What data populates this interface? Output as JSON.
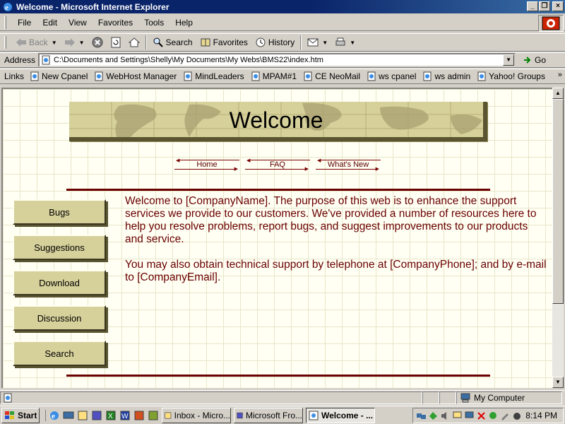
{
  "window": {
    "title": "Welcome - Microsoft Internet Explorer"
  },
  "menu": [
    "File",
    "Edit",
    "View",
    "Favorites",
    "Tools",
    "Help"
  ],
  "toolbar": {
    "back": "Back",
    "search": "Search",
    "favorites": "Favorites",
    "history": "History"
  },
  "address": {
    "label": "Address",
    "value": "C:\\Documents and Settings\\Shelly\\My Documents\\My Webs\\BMS22\\index.htm",
    "go": "Go"
  },
  "links": {
    "label": "Links",
    "items": [
      "New Cpanel",
      "WebHost Manager",
      "MindLeaders",
      "MPAM#1",
      "CE NeoMail",
      "ws cpanel",
      "ws admin",
      "Yahoo! Groups"
    ],
    "more": "»"
  },
  "page": {
    "banner_title": "Welcome",
    "top_nav": [
      "Home",
      "FAQ",
      "What's New"
    ],
    "side_nav": [
      "Bugs",
      "Suggestions",
      "Download",
      "Discussion",
      "Search"
    ],
    "paragraph1": "Welcome to [CompanyName]. The purpose of this web is to enhance the support services we provide to our customers. We've provided a number of resources here to help you resolve problems, report bugs, and suggest improvements to our products and service.",
    "paragraph2": "You may also obtain technical support by telephone at [CompanyPhone]; and by e-mail to [CompanyEmail]."
  },
  "status": {
    "zone": "My Computer"
  },
  "taskbar": {
    "start": "Start",
    "tasks": [
      {
        "label": "Inbox - Micro...",
        "active": false
      },
      {
        "label": "Microsoft Fro...",
        "active": false
      },
      {
        "label": "Welcome - ...",
        "active": true
      }
    ],
    "clock": "8:14 PM"
  },
  "colors": {
    "accent_dark_red": "#6a0000",
    "banner_tan": "#d6d09a",
    "title_bar": "#0a246a"
  }
}
